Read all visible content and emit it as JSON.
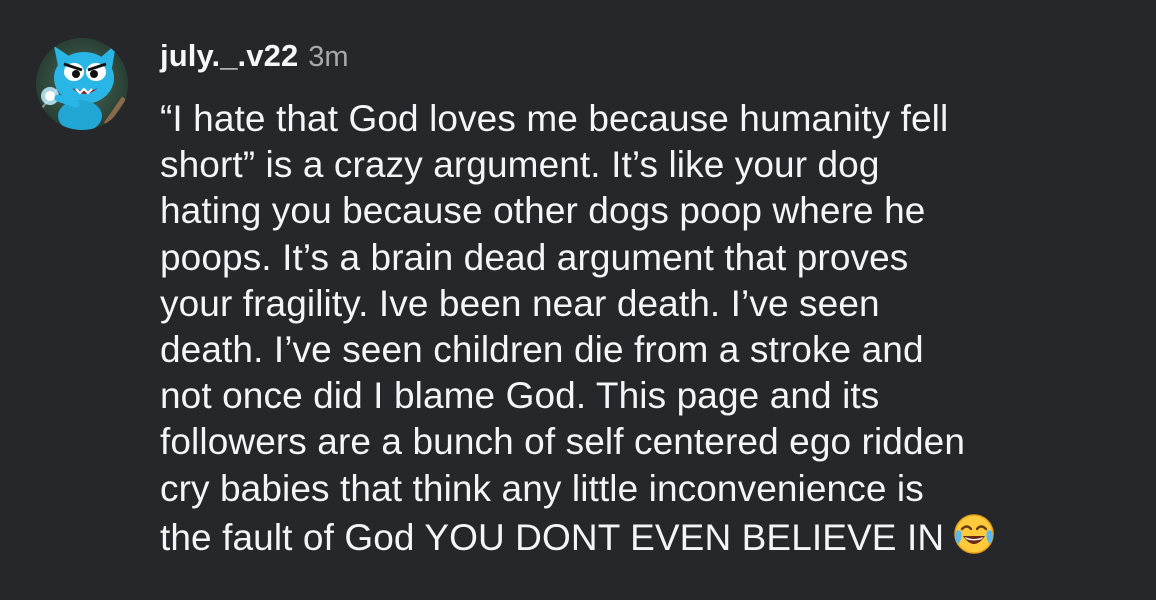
{
  "comment": {
    "username": "july._.v22",
    "timestamp": "3m",
    "avatar_icon": "cartoon-cat-avatar-icon",
    "body_lines": [
      "“I hate that God loves me because humanity fell",
      "short” is a crazy argument. It’s like your dog",
      "hating you because other dogs poop where he",
      "poops. It’s a brain dead argument that proves",
      "your fragility. Ive been near death. I’ve seen",
      "death. I’ve seen children die from a stroke and",
      "not once did I blame God. This page and its",
      "followers are a bunch of self centered ego ridden",
      "cry babies that think any little inconvenience is",
      "the fault of God YOU DONT EVEN BELIEVE IN"
    ],
    "trailing_emoji": "face-with-tears-of-joy-icon"
  },
  "colors": {
    "background": "#25272b",
    "text": "#f4f5f6",
    "timestamp": "#a6a8ac"
  }
}
